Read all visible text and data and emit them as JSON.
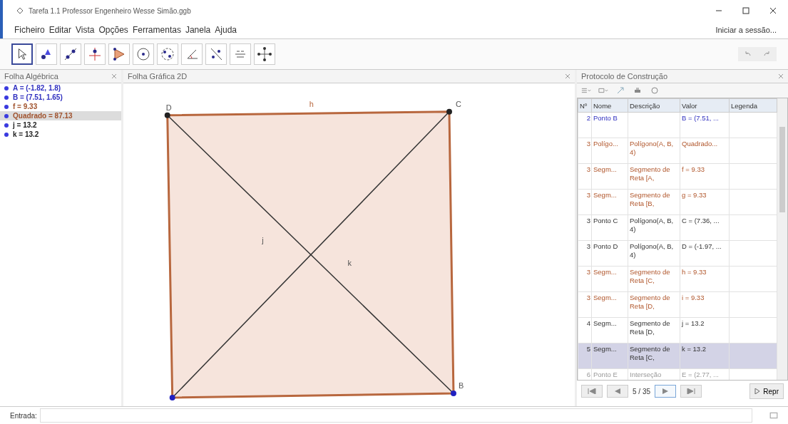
{
  "window": {
    "title": "Tarefa 1.1 Professor Engenheiro Wesse Simão.ggb"
  },
  "menu": [
    "Ficheiro",
    "Editar",
    "Vista",
    "Opções",
    "Ferramentas",
    "Janela",
    "Ajuda"
  ],
  "sign_in": "Iniciar a sessão...",
  "tools": [
    {
      "selected": true
    },
    {
      "selected": false
    },
    {
      "selected": false
    },
    {
      "selected": false
    },
    {
      "selected": false
    },
    {
      "selected": false
    },
    {
      "selected": false
    },
    {
      "selected": false
    },
    {
      "selected": false
    },
    {
      "selected": false
    },
    {
      "selected": false
    }
  ],
  "algebra": {
    "title": "Folha Algébrica",
    "items": [
      {
        "text": "A = (-1.82, 1.8)",
        "color": "#3030c0",
        "selected": false
      },
      {
        "text": "B = (7.51, 1.65)",
        "color": "#3030c0",
        "selected": false
      },
      {
        "text": "f = 9.33",
        "color": "#a0522d",
        "selected": false
      },
      {
        "text": "Quadrado = 87.13",
        "color": "#a0522d",
        "selected": true
      },
      {
        "text": "j = 13.2",
        "color": "#202020",
        "selected": false
      },
      {
        "text": "k = 13.2",
        "color": "#202020",
        "selected": false
      }
    ]
  },
  "graphics": {
    "title": "Folha Gráfica 2D",
    "points": [
      "D",
      "C",
      "B"
    ],
    "segment_labels": [
      "h",
      "j",
      "k"
    ]
  },
  "protocol": {
    "title": "Protocolo de Construção",
    "columns": [
      "Nº",
      "Nome",
      "Descrição",
      "Valor",
      "Legenda"
    ],
    "rows": [
      {
        "n": "2",
        "name": "Ponto B",
        "desc": "",
        "value": "B = (7.51, ...",
        "kind": "free",
        "selected": false
      },
      {
        "n": "3",
        "name": "Polígo...",
        "desc": "Polígono(A, B, 4)",
        "value": "Quadrado...",
        "kind": "polygon",
        "selected": false
      },
      {
        "n": "3",
        "name": "Segm...",
        "desc": "Segmento de Reta [A,",
        "value": "f = 9.33",
        "kind": "polygon",
        "selected": false
      },
      {
        "n": "3",
        "name": "Segm...",
        "desc": "Segmento de Reta [B,",
        "value": "g = 9.33",
        "kind": "polygon",
        "selected": false
      },
      {
        "n": "3",
        "name": "Ponto C",
        "desc": "Polígono(A, B, 4)",
        "value": "C = (7.36, ...",
        "kind": "dependent",
        "selected": false
      },
      {
        "n": "3",
        "name": "Ponto D",
        "desc": "Polígono(A, B, 4)",
        "value": "D = (-1.97, ...",
        "kind": "dependent",
        "selected": false
      },
      {
        "n": "3",
        "name": "Segm...",
        "desc": "Segmento de Reta [C,",
        "value": "h = 9.33",
        "kind": "polygon",
        "selected": false
      },
      {
        "n": "3",
        "name": "Segm...",
        "desc": "Segmento de Reta [D,",
        "value": "i = 9.33",
        "kind": "polygon",
        "selected": false
      },
      {
        "n": "4",
        "name": "Segm...",
        "desc": "Segmento de Reta [D,",
        "value": "j = 13.2",
        "kind": "dependent",
        "selected": false
      },
      {
        "n": "5",
        "name": "Segm...",
        "desc": "Segmento de Reta [C,",
        "value": "k = 13.2",
        "kind": "dependent",
        "selected": true
      },
      {
        "n": "6",
        "name": "Ponto E",
        "desc": "Interseção",
        "value": "E = (2.77, ...",
        "kind": "hidden",
        "selected": false
      }
    ],
    "step": "5 / 35",
    "play": "Repr"
  },
  "input": {
    "label": "Entrada:"
  }
}
